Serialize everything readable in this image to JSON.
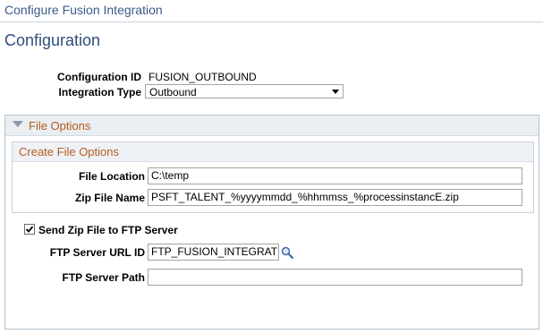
{
  "header": {
    "title": "Configure Fusion Integration"
  },
  "page": {
    "title": "Configuration"
  },
  "form": {
    "config_id_label": "Configuration ID",
    "config_id_value": "FUSION_OUTBOUND",
    "integration_type_label": "Integration Type",
    "integration_type_value": "Outbound"
  },
  "file_options": {
    "title": "File Options",
    "expanded": true,
    "create_file_options": {
      "title": "Create File Options",
      "file_location_label": "File Location",
      "file_location_value": "C:\\temp",
      "zip_file_name_label": "Zip File Name",
      "zip_file_name_value": "PSFT_TALENT_%yyyymmdd_%hhmmss_%processinstancE.zip"
    },
    "send_zip": {
      "label": "Send Zip File to FTP Server",
      "checked": true
    },
    "ftp_url_id_label": "FTP Server URL ID",
    "ftp_url_id_value": "FTP_FUSION_INTEGRATION",
    "ftp_path_label": "FTP Server Path",
    "ftp_path_value": ""
  },
  "icons": {
    "lookup": "magnifier-icon",
    "collapse": "triangle-down-icon",
    "dropdown": "chevron-down-icon"
  }
}
